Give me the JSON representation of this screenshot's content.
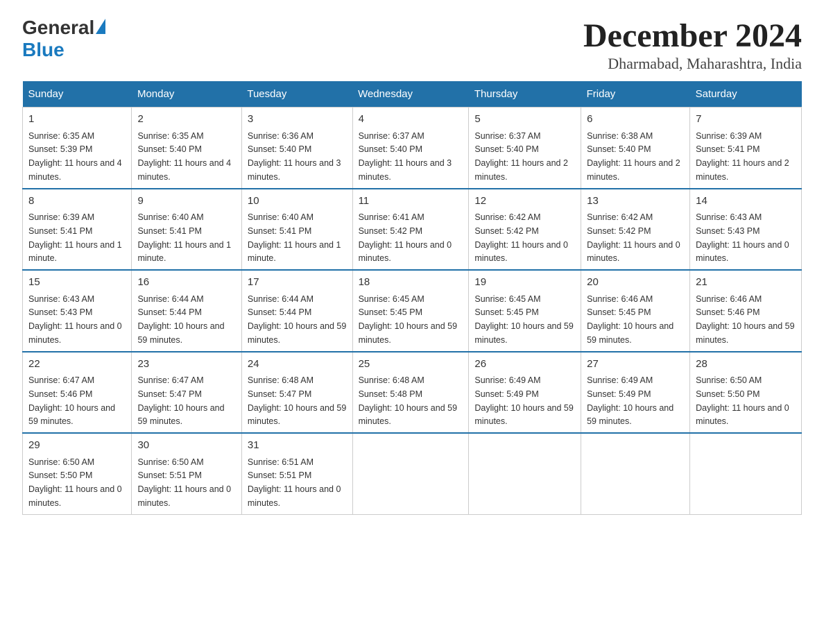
{
  "logo": {
    "general": "General",
    "blue": "Blue"
  },
  "title": "December 2024",
  "subtitle": "Dharmabad, Maharashtra, India",
  "headers": [
    "Sunday",
    "Monday",
    "Tuesday",
    "Wednesday",
    "Thursday",
    "Friday",
    "Saturday"
  ],
  "weeks": [
    [
      {
        "day": "1",
        "sunrise": "6:35 AM",
        "sunset": "5:39 PM",
        "daylight": "11 hours and 4 minutes."
      },
      {
        "day": "2",
        "sunrise": "6:35 AM",
        "sunset": "5:40 PM",
        "daylight": "11 hours and 4 minutes."
      },
      {
        "day": "3",
        "sunrise": "6:36 AM",
        "sunset": "5:40 PM",
        "daylight": "11 hours and 3 minutes."
      },
      {
        "day": "4",
        "sunrise": "6:37 AM",
        "sunset": "5:40 PM",
        "daylight": "11 hours and 3 minutes."
      },
      {
        "day": "5",
        "sunrise": "6:37 AM",
        "sunset": "5:40 PM",
        "daylight": "11 hours and 2 minutes."
      },
      {
        "day": "6",
        "sunrise": "6:38 AM",
        "sunset": "5:40 PM",
        "daylight": "11 hours and 2 minutes."
      },
      {
        "day": "7",
        "sunrise": "6:39 AM",
        "sunset": "5:41 PM",
        "daylight": "11 hours and 2 minutes."
      }
    ],
    [
      {
        "day": "8",
        "sunrise": "6:39 AM",
        "sunset": "5:41 PM",
        "daylight": "11 hours and 1 minute."
      },
      {
        "day": "9",
        "sunrise": "6:40 AM",
        "sunset": "5:41 PM",
        "daylight": "11 hours and 1 minute."
      },
      {
        "day": "10",
        "sunrise": "6:40 AM",
        "sunset": "5:41 PM",
        "daylight": "11 hours and 1 minute."
      },
      {
        "day": "11",
        "sunrise": "6:41 AM",
        "sunset": "5:42 PM",
        "daylight": "11 hours and 0 minutes."
      },
      {
        "day": "12",
        "sunrise": "6:42 AM",
        "sunset": "5:42 PM",
        "daylight": "11 hours and 0 minutes."
      },
      {
        "day": "13",
        "sunrise": "6:42 AM",
        "sunset": "5:42 PM",
        "daylight": "11 hours and 0 minutes."
      },
      {
        "day": "14",
        "sunrise": "6:43 AM",
        "sunset": "5:43 PM",
        "daylight": "11 hours and 0 minutes."
      }
    ],
    [
      {
        "day": "15",
        "sunrise": "6:43 AM",
        "sunset": "5:43 PM",
        "daylight": "11 hours and 0 minutes."
      },
      {
        "day": "16",
        "sunrise": "6:44 AM",
        "sunset": "5:44 PM",
        "daylight": "10 hours and 59 minutes."
      },
      {
        "day": "17",
        "sunrise": "6:44 AM",
        "sunset": "5:44 PM",
        "daylight": "10 hours and 59 minutes."
      },
      {
        "day": "18",
        "sunrise": "6:45 AM",
        "sunset": "5:45 PM",
        "daylight": "10 hours and 59 minutes."
      },
      {
        "day": "19",
        "sunrise": "6:45 AM",
        "sunset": "5:45 PM",
        "daylight": "10 hours and 59 minutes."
      },
      {
        "day": "20",
        "sunrise": "6:46 AM",
        "sunset": "5:45 PM",
        "daylight": "10 hours and 59 minutes."
      },
      {
        "day": "21",
        "sunrise": "6:46 AM",
        "sunset": "5:46 PM",
        "daylight": "10 hours and 59 minutes."
      }
    ],
    [
      {
        "day": "22",
        "sunrise": "6:47 AM",
        "sunset": "5:46 PM",
        "daylight": "10 hours and 59 minutes."
      },
      {
        "day": "23",
        "sunrise": "6:47 AM",
        "sunset": "5:47 PM",
        "daylight": "10 hours and 59 minutes."
      },
      {
        "day": "24",
        "sunrise": "6:48 AM",
        "sunset": "5:47 PM",
        "daylight": "10 hours and 59 minutes."
      },
      {
        "day": "25",
        "sunrise": "6:48 AM",
        "sunset": "5:48 PM",
        "daylight": "10 hours and 59 minutes."
      },
      {
        "day": "26",
        "sunrise": "6:49 AM",
        "sunset": "5:49 PM",
        "daylight": "10 hours and 59 minutes."
      },
      {
        "day": "27",
        "sunrise": "6:49 AM",
        "sunset": "5:49 PM",
        "daylight": "10 hours and 59 minutes."
      },
      {
        "day": "28",
        "sunrise": "6:50 AM",
        "sunset": "5:50 PM",
        "daylight": "11 hours and 0 minutes."
      }
    ],
    [
      {
        "day": "29",
        "sunrise": "6:50 AM",
        "sunset": "5:50 PM",
        "daylight": "11 hours and 0 minutes."
      },
      {
        "day": "30",
        "sunrise": "6:50 AM",
        "sunset": "5:51 PM",
        "daylight": "11 hours and 0 minutes."
      },
      {
        "day": "31",
        "sunrise": "6:51 AM",
        "sunset": "5:51 PM",
        "daylight": "11 hours and 0 minutes."
      },
      null,
      null,
      null,
      null
    ]
  ]
}
